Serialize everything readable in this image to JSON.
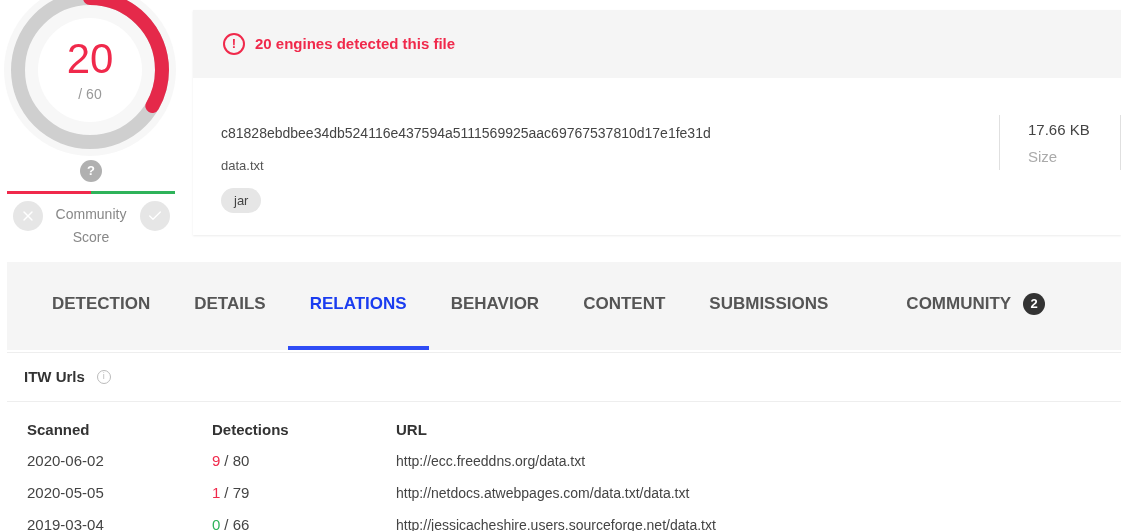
{
  "score": {
    "value": "20",
    "total": "/ 60",
    "level": 0.333
  },
  "community": {
    "marker": "?",
    "label": "Community Score",
    "level": 0.5
  },
  "alert": {
    "icon": "!",
    "text": "20 engines detected this file"
  },
  "file": {
    "hash": "c81828ebdbee34db524116e437594a5111569925aac69767537810d17e1fe31d",
    "name": "data.txt",
    "tags": [
      "jar"
    ],
    "size": "17.66 KB",
    "size_label": "Size"
  },
  "tabs": [
    {
      "label": "DETECTION",
      "selected": false
    },
    {
      "label": "DETAILS",
      "selected": false
    },
    {
      "label": "RELATIONS",
      "selected": true
    },
    {
      "label": "BEHAVIOR",
      "selected": false
    },
    {
      "label": "CONTENT",
      "selected": false
    },
    {
      "label": "SUBMISSIONS",
      "selected": false
    },
    {
      "label": "COMMUNITY",
      "selected": false,
      "badge": "2"
    }
  ],
  "section": {
    "title": "ITW Urls",
    "info_icon": "i"
  },
  "table": {
    "columns": [
      "Scanned",
      "Detections",
      "URL"
    ],
    "rows": [
      {
        "scanned": "2020-06-02",
        "positives": "9",
        "total": "/ 80",
        "color": "#f0294b",
        "url": "http://ecc.freeddns.org/data.txt"
      },
      {
        "scanned": "2020-05-05",
        "positives": "1",
        "total": "/ 79",
        "color": "#f0294b",
        "url": "http://netdocs.atwebpages.com/data.txt/data.txt"
      },
      {
        "scanned": "2019-03-04",
        "positives": "0",
        "total": "/ 66",
        "color": "#2fb35a",
        "url": "http://jessicacheshire.users.sourceforge.net/data.txt"
      }
    ]
  }
}
